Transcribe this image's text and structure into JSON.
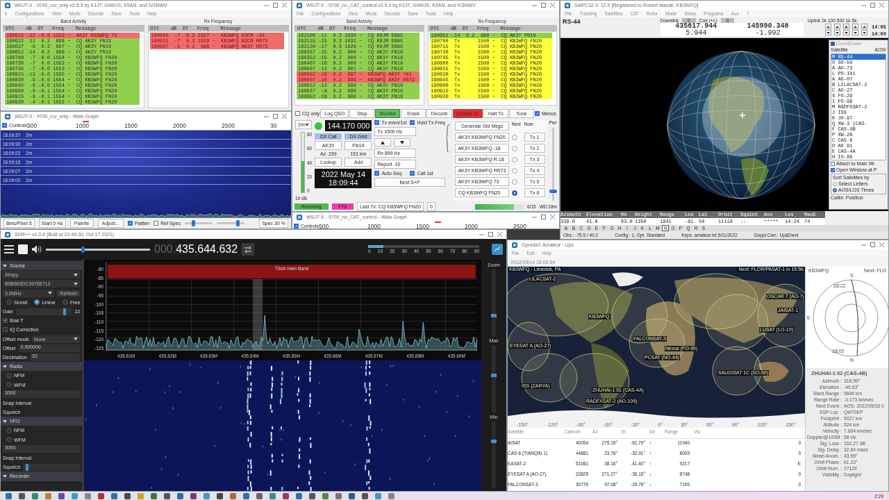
{
  "wsjtx_rcv_only": {
    "title": "WSJT-X - 9700_rcv_only   v2.5.3   by K1JT, G4WJS, K9AN, and IV3NWV",
    "menu": [
      "e",
      "Configurations",
      "View",
      "Mode",
      "Decode",
      "Save",
      "Tools",
      "Help"
    ],
    "band_activity": {
      "title": "Band Activity",
      "columns": [
        "UTC",
        "dB",
        "DT",
        "Freq",
        "Message"
      ],
      "rows": [
        {
          "text": "180615 -12 -0.0 1553 ~  AK3Y KB3WFQ 73",
          "kind": "reply"
        },
        {
          "text": "180622  11  0.2  898 ~  CQ AK3Y FN19",
          "kind": "cq"
        },
        {
          "text": "180637  -8  0.2  897 ~  CQ AK3Y FN19",
          "kind": "cq"
        },
        {
          "text": "180652 -14  0.2  899 ~  CQ AK3Y FN19",
          "kind": "cq"
        },
        {
          "text": "180700  -7 -0.0 1554 ~  CQ KB3WFQ FN20",
          "kind": "cq"
        },
        {
          "text": "180730  -7  0.0 1553 ~  CQ KB3WFQ FN20",
          "kind": "cq"
        },
        {
          "text": "180745  -7 -0.0 1553 ~  CQ KB3WFQ FN20",
          "kind": "cq"
        },
        {
          "text": "180815 -13 -0.0 1555 ~  CQ KB3WFQ FN20",
          "kind": "cq"
        },
        {
          "text": "180830  -9 -0.0 1554 ~  CQ KB3WFQ FN20",
          "kind": "cq"
        },
        {
          "text": "180845  -6 -0.0 1554 ~  CQ KB3WFQ FN20",
          "kind": "cq"
        },
        {
          "text": "180900  -9 -0.1 1554 ~  CQ KB3WFQ FN20",
          "kind": "cq"
        },
        {
          "text": "180915  -8 -0.1 1554 ~  CQ KB3WFQ FN20",
          "kind": "cq"
        },
        {
          "text": "180930  -4 -0.1 1553 ~  CQ KB3WFQ FN20",
          "kind": "cq"
        }
      ]
    },
    "rx_frequency": {
      "title": "Rx Frequency",
      "columns": [
        "UTC",
        "dB",
        "DT",
        "Freq",
        "Message"
      ],
      "rows": [
        {
          "text": "180600  -7  0.3 1557 ~  KB3WFQ N3CM -01",
          "kind": "reply"
        },
        {
          "text": "180615  -7  0.3 1559 ~  KB3WFQ N3CM RR73",
          "kind": "reply"
        },
        {
          "text": "180607  -5  0.2  898 ~  KB3WFQ AK3Y RR73",
          "kind": "reply"
        }
      ]
    }
  },
  "wide_graph_rcv_only": {
    "title": "WSJT-X - 9700_rcv_only - Wide Graph",
    "controls": {
      "label": "Controls",
      "checked": true
    },
    "scale": [
      "500",
      "1000",
      "1500",
      "2000",
      "2500",
      "30"
    ],
    "timestamps": [
      {
        "time": "18:09:37",
        "mode": "2m"
      },
      {
        "time": "18:09:30",
        "mode": "2m"
      },
      {
        "time": "18:09:22",
        "mode": "2m"
      },
      {
        "time": "18:09:15",
        "mode": "2m"
      },
      {
        "time": "18:09:07",
        "mode": "2m"
      },
      {
        "time": "18:09:00",
        "mode": "2m"
      }
    ],
    "bins_per_pixel": "Bins/Pixel  5",
    "start": "Start 0 Hz",
    "buttons": [
      "Palette",
      "Adjust..."
    ],
    "checks": [
      {
        "label": "Flatten",
        "checked": true
      },
      {
        "label": "Ref Spec",
        "checked": false
      }
    ],
    "sliders": [
      {
        "level": 0.3
      },
      {
        "level": 0.75
      }
    ],
    "spec": "Spec 30 %"
  },
  "wsjtx_no_cat": {
    "title": "WSJT-X - 9700_no_CAT_control   v2.5.3   by K1JT, G4WJS, K9AN, and IV3NWV",
    "menu": [
      "File",
      "Configurations",
      "View",
      "Mode",
      "Decode",
      "Save",
      "Tools",
      "Help"
    ],
    "band_activity": {
      "title": "Band Activity",
      "columns": [
        "UTC",
        "dB",
        "DT",
        "Freq",
        "Message"
      ],
      "rows": [
        {
          "text": "162100 -11  0.3 1030 ~  CQ K0JM EN85",
          "kind": "cq"
        },
        {
          "text": "162115 -15  0.3 1031 ~  CQ K0JM EN85",
          "kind": "cq"
        },
        {
          "text": "162130 -17  0.3 1029 ~  CQ K0JM EN85",
          "kind": "cq"
        },
        {
          "text": "180337 -15  0.2  900 ~  CQ AK3Y FN19",
          "kind": "cq"
        },
        {
          "text": "180352 -15  0.2  900 ~  CQ AK3Y FN19",
          "kind": "cq"
        },
        {
          "text": "180407 -16  0.2  900 ~  CQ AK3Y FN19",
          "kind": "cq"
        },
        {
          "text": "180507 -12  0.2  901 ~  CQ AK3Y FN19",
          "kind": "cq"
        },
        {
          "text": "180552 -18  0.2  897 ~  KB3WFQ AK3Y +01",
          "kind": "reply"
        },
        {
          "text": "180607 -10  0.2  899 ~  KB3WFQ AK3Y RR73",
          "kind": "reply"
        },
        {
          "text": "180622 -12  0.2  896 ~  CQ AK3Y FN19",
          "kind": "cq"
        },
        {
          "text": "180637  -8  0.2  896 ~  CQ AK3Y FN19",
          "kind": "cq"
        },
        {
          "text": "180652 -18  0.2  899 ~  CQ AK3Y FN19",
          "kind": "cq"
        }
      ]
    },
    "rx_frequency": {
      "title": "Rx Frequency",
      "columns": [
        "UTC",
        "dB",
        "DT",
        "Freq",
        "Message"
      ],
      "rows": [
        {
          "text": "180652 -14  0.2  899 ~  CQ AK3Y FN19",
          "kind": "cq"
        },
        {
          "text": "180700  Tx      1500 ~  CQ KB3WFQ FN20",
          "kind": "tx"
        },
        {
          "text": "180715  Tx      1500 ~  CQ KB3WFQ FN20",
          "kind": "tx"
        },
        {
          "text": "180730  Tx      1500 ~  CQ KB3WFQ FN20",
          "kind": "tx"
        },
        {
          "text": "180745  Tx      1500 ~  CQ KB3WFQ FN20",
          "kind": "tx"
        },
        {
          "text": "180800  Tx      1500 ~  CQ KB3WFQ FN20",
          "kind": "tx"
        },
        {
          "text": "180815  Tx      1500 ~  CQ KB3WFQ FN20",
          "kind": "tx"
        },
        {
          "text": "180830  Tx      1500 ~  CQ KB3WFQ FN20",
          "kind": "tx"
        },
        {
          "text": "180845  Tx      1500 ~  CQ KB3WFQ FN20",
          "kind": "tx"
        },
        {
          "text": "180900  Tx      1500 ~  CQ KB3WFQ FN20",
          "kind": "tx"
        },
        {
          "text": "180915  Tx      1500 ~  CQ KB3WFQ FN20",
          "kind": "tx"
        },
        {
          "text": "180930  Tx      1500 ~  CQ KB3WFQ FN20",
          "kind": "tx"
        }
      ]
    },
    "controls_row": [
      {
        "kind": "check",
        "label": "CQ only",
        "checked": false
      },
      {
        "kind": "button",
        "label": "Log QSO",
        "on": false
      },
      {
        "kind": "button",
        "label": "Stop",
        "on": false
      },
      {
        "kind": "button",
        "label": "Monitor",
        "on": true,
        "color": "#5ec45a"
      },
      {
        "kind": "button",
        "label": "Erase",
        "on": false
      },
      {
        "kind": "button",
        "label": "Decode",
        "on": false
      },
      {
        "kind": "button",
        "label": "Enable Tx",
        "on": true,
        "color": "#e8282c"
      },
      {
        "kind": "button",
        "label": "Halt Tx",
        "on": false
      },
      {
        "kind": "button",
        "label": "Tune",
        "on": false
      },
      {
        "kind": "check",
        "label": "Menus",
        "checked": true
      }
    ],
    "band": "2m",
    "frequency": "144.170 000",
    "dx_call_label": "DX Call",
    "dx_grid_label": "DX Grid",
    "dx_call": "AK3Y",
    "dx_grid": "FN19",
    "azimuth": "Az: 239",
    "distance": "151 km",
    "lookup": "Lookup",
    "add": "Add",
    "date": "2022 May 14",
    "time": "18:09:44",
    "meter": {
      "ticks": [
        "80",
        "60",
        "40",
        "20",
        "0"
      ],
      "level": 0.52,
      "reading": "14 dB"
    },
    "tx_even": {
      "label": "Tx even/1st",
      "checked": true
    },
    "hold_tx_freq": {
      "label": "Hold Tx Freq",
      "checked": true
    },
    "tx_freq": "Tx  1500 Hz",
    "rx_freq": "Rx  899 Hz",
    "report": "Report -10",
    "auto_seq": {
      "label": "Auto Seq",
      "checked": true
    },
    "call_1st": {
      "label": "Call 1st",
      "checked": true
    },
    "best_sp": "Best S+P",
    "messages": {
      "generate": "Generate Std Msgs",
      "next_label": "Next",
      "now_label": "Now",
      "rows": [
        {
          "text": "AK3Y KB3WFQ FN20",
          "selected": false,
          "now": "Tx 1"
        },
        {
          "text": "AK3Y KB3WFQ -18",
          "selected": false,
          "now": "Tx 2"
        },
        {
          "text": "AK3Y KB3WFQ R-18",
          "selected": false,
          "now": "Tx 3"
        },
        {
          "text": "AK3Y KB3WFQ RR73",
          "selected": false,
          "now": "Tx 4"
        },
        {
          "text": "AK3Y KB3WFQ 73",
          "selected": false,
          "now": "Tx 5"
        },
        {
          "text": "CQ KB3WFQ FN20",
          "selected": true,
          "now": "Tx 6"
        }
      ]
    },
    "power": {
      "label": "Pwr",
      "level": 0.12
    },
    "status_bar": {
      "state": "Receiving",
      "mode": "FT8",
      "last_tx": "Last Tx: CQ KB3WFQ FN20",
      "count": "0",
      "progress": {
        "level": 0.8
      },
      "period": "6/15",
      "watchdog": "WD:18m"
    }
  },
  "wide_graph_no_cat": {
    "title": "WSJT-X - 9700_no_CAT_control - Wide Graph",
    "controls": {
      "label": "Controls",
      "checked": true
    },
    "scale": [
      "500",
      "1000",
      "1500",
      "2000",
      "2500"
    ]
  },
  "satpc32": {
    "title": "SatPC32 V. 12.9   [Registered to Robert Mazde, KB3WFQ]",
    "menu": [
      "File",
      "Tracking",
      "Satellites",
      "CAT",
      "Rotor",
      "Mode",
      "Setup",
      "Programs",
      "Aux",
      "?"
    ],
    "satellite": "RS-44",
    "downlink_label": "Downlink",
    "downlink_value": "0",
    "corr_label": "Corr.(+/-)",
    "corr_value": "0",
    "uplink_label": "Uplink",
    "steps": [
      "2k",
      "100",
      "500",
      "1k",
      "5k"
    ],
    "downlink_freq": "435617.944",
    "uplink_freq": "145990.348",
    "downlink_doppler": "5.944",
    "uplink_doppler": "-1.992",
    "side_times": [
      "14:05",
      "14:09"
    ],
    "countdown": {
      "title": "CountDown",
      "columns": [
        "Satellite",
        "AOS/"
      ],
      "items": [
        {
          "letter": "M",
          "name": "RS-44",
          "selected": true
        },
        {
          "letter": "O",
          "name": "SO-50",
          "selected": false
        },
        {
          "letter": "A",
          "name": "AO-73",
          "selected": false
        },
        {
          "letter": "L",
          "name": "PO-101",
          "selected": false
        },
        {
          "letter": "A",
          "name": "AO-07",
          "selected": false
        },
        {
          "letter": "B",
          "name": "LILACSAT-2",
          "selected": false
        },
        {
          "letter": "C",
          "name": "AO-27",
          "selected": false
        },
        {
          "letter": "S",
          "name": "FO-29",
          "selected": false
        },
        {
          "letter": "I",
          "name": "FO-99",
          "selected": false
        },
        {
          "letter": "M",
          "name": "RADFXSAT-2",
          "selected": false
        },
        {
          "letter": "J",
          "name": "ISS",
          "selected": false
        },
        {
          "letter": "K",
          "name": "JO-97",
          "selected": false
        },
        {
          "letter": "Q",
          "name": "XW-3 (CAS-",
          "selected": false
        },
        {
          "letter": "F",
          "name": "CAS-4B",
          "selected": false
        },
        {
          "letter": "P",
          "name": "XW-2A",
          "selected": false
        },
        {
          "letter": "C",
          "name": "CAS-6",
          "selected": false
        },
        {
          "letter": "D",
          "name": "AO 91",
          "selected": false
        },
        {
          "letter": "E",
          "name": "CAS-4A",
          "selected": false
        },
        {
          "letter": "H",
          "name": "IO-86",
          "selected": false
        }
      ],
      "checks": [
        {
          "label": "Attach to Main Wi",
          "checked": false
        },
        {
          "label": "Open Window at P",
          "checked": true
        }
      ],
      "sort": {
        "title": "Sort Satellites by",
        "options": [
          {
            "label": "Select Letters",
            "selected": false
          },
          {
            "label": "AOS/LOS Times",
            "selected": true
          }
        ]
      },
      "calibr": "Calibr. Position"
    },
    "table": {
      "columns": [
        "Azimuth",
        "Elevation",
        "MA",
        "Height",
        "Range",
        "Lon",
        "Lat",
        "Orbit",
        "Squint",
        "Aos",
        "Los",
        "MaxE"
      ],
      "values": [
        "339.0",
        "41.8",
        "63.0",
        "1350",
        "1841",
        "-81",
        "50",
        "11118",
        "--",
        "*****",
        "14:24",
        "74"
      ]
    },
    "letters": [
      {
        "letter": "A",
        "selected": false
      },
      {
        "letter": "B",
        "selected": false
      },
      {
        "letter": "C",
        "selected": false
      },
      {
        "letter": "D",
        "selected": false
      },
      {
        "letter": "E",
        "selected": false
      },
      {
        "letter": "F",
        "selected": false
      },
      {
        "letter": "G",
        "selected": false
      },
      {
        "letter": "H",
        "selected": false
      },
      {
        "letter": "I",
        "selected": false
      },
      {
        "letter": "J",
        "selected": false
      },
      {
        "letter": "K",
        "selected": false
      },
      {
        "letter": "L",
        "selected": false
      },
      {
        "letter": "M",
        "selected": false
      },
      {
        "letter": "N",
        "selected": true
      },
      {
        "letter": "O",
        "selected": false
      },
      {
        "letter": "P",
        "selected": false
      },
      {
        "letter": "Q",
        "selected": false
      },
      {
        "letter": "R",
        "selected": false
      },
      {
        "letter": "S",
        "selected": false
      }
    ],
    "status_bar": [
      "Obs.: -75.5 / 40.2",
      "Config.: 1, Opt. Standard",
      "Keps: amateur.txt  5/11/2022",
      "Doppl.Corr.: Up&Dwnl"
    ]
  },
  "sdrpp": {
    "title": "SDR++ v1.0.4 (Built at 22:46:30, Oct 17 2021)",
    "volume": {
      "level": 0.35
    },
    "frequency": {
      "prefix": "000.",
      "digits": "435.644.632"
    },
    "snr": {
      "ticks": [
        "0",
        "10",
        "20",
        "30",
        "40",
        "50",
        "60",
        "70",
        "80",
        "90"
      ],
      "level": 0.14
    },
    "sidebar": [
      {
        "kind": "header",
        "label": "Source"
      },
      {
        "kind": "select",
        "value": "Airspy"
      },
      {
        "kind": "select",
        "value": "B58069DC39765713"
      },
      {
        "kind": "select",
        "value": "3.0MHz",
        "button": "Refresh"
      },
      {
        "kind": "radios",
        "options": [
          {
            "label": "Sensit",
            "selected": false
          },
          {
            "label": "Linear",
            "selected": true
          },
          {
            "label": "Free",
            "selected": false
          }
        ]
      },
      {
        "kind": "slider",
        "label": "Gain",
        "value": "13",
        "level": 0.9
      },
      {
        "kind": "check",
        "label": "Bias T",
        "checked": true
      },
      {
        "kind": "check",
        "label": "IQ Correction",
        "checked": false
      },
      {
        "kind": "select",
        "label": "Offset mode",
        "value": "None"
      },
      {
        "kind": "field",
        "label": "Offset",
        "value": "0.000000"
      },
      {
        "kind": "field",
        "label": "Decimation",
        "value": "32"
      },
      {
        "kind": "header",
        "label": "Radio"
      },
      {
        "kind": "radios",
        "options": [
          {
            "label": "NFM",
            "selected": false
          }
        ]
      },
      {
        "kind": "radios",
        "options": [
          {
            "label": "WFM",
            "selected": false
          }
        ]
      },
      {
        "kind": "field",
        "value": "3000"
      },
      {
        "kind": "text",
        "label": "Snap Interval"
      },
      {
        "kind": "text",
        "label": "Squelch"
      },
      {
        "kind": "header",
        "label": "VFO"
      },
      {
        "kind": "radios",
        "options": [
          {
            "label": "NFM",
            "selected": false
          }
        ]
      },
      {
        "kind": "radios",
        "options": [
          {
            "label": "WFM",
            "selected": false
          }
        ]
      },
      {
        "kind": "field",
        "value": "3000"
      },
      {
        "kind": "text",
        "label": "Snap Interval"
      },
      {
        "kind": "slider",
        "label": "Squelch",
        "level": 0.1
      },
      {
        "kind": "header",
        "label": "Recorder"
      }
    ],
    "fft": {
      "band_label": "70cm Ham Band",
      "yticks": [
        "-80",
        "-85",
        "-90",
        "-95",
        "-100",
        "-105",
        "-110",
        "-115",
        "-120",
        "-125"
      ],
      "xticks": [
        "435.61M",
        "435.62M",
        "435.63M",
        "435.64M",
        "435.65M",
        "435.66M",
        "435.67M",
        "435.68M",
        "435.69M"
      ]
    },
    "right_controls": [
      {
        "label": "Zoom",
        "level": 0.3
      },
      {
        "label": "Max",
        "level": 0.55
      },
      {
        "label": "Min",
        "level": 0.7
      }
    ]
  },
  "gpredict": {
    "title": "Gpredict: Amateur - Ups",
    "menu": [
      "File",
      "Edit",
      "Help"
    ],
    "timestamp": "2022/05/14 18:09:54",
    "map": {
      "qth": "KB3WFQ - Limerick, PA",
      "next": "Next: FLORIPASAT-1 in 15:56",
      "labels": [
        "LILACSAT-2",
        "KB3WFQ",
        "EYESAT A (AO-27)",
        "FALCONSAT-3",
        "Nexus (FO-99)",
        "PCSAT (NO-44)",
        "SAUDISAT 1C (SO-50)",
        "OSCAR 7 (AO-7)",
        "JAISAT-1",
        "LUSAT (LO-19)",
        "ZHUHAI-1 01 (CAS-4A)",
        "RADFXSAT-2 (AO-109)",
        "ISS (ZARYA)"
      ],
      "longitudes": [
        "-150°",
        "-120°",
        "-90°",
        "-60°",
        "-30°",
        "0°",
        "30°",
        "60°",
        "90°",
        "120°",
        "150°"
      ]
    },
    "polar": {
      "qth": "KB3WFQ",
      "next": "Next: FLO",
      "south": "S",
      "north": "N",
      "east": "E",
      "start_time": "18:22",
      "end_time": "18:02"
    },
    "table": {
      "columns": [
        "Satellite",
        "Catnum",
        "Az",
        "El",
        "Dir",
        "Range",
        "Vis"
      ],
      "rows": [
        {
          "cells": [
            "AISAT",
            "40054",
            "275.15°",
            "-61.70°",
            "↑",
            "11940",
            "0"
          ]
        },
        {
          "cells": [
            "CAS-6 (TIANQIN 1)",
            "44881",
            "23.76°",
            "-32.91°",
            "↑",
            "8009",
            "0"
          ]
        },
        {
          "cells": [
            "EASAT-2",
            "51081",
            "38.16°",
            "-41.40°",
            "↑",
            "9217",
            "E"
          ]
        },
        {
          "cells": [
            "EYESAT A (AO-27)",
            "22825",
            "271.27°",
            "-36.15°",
            "↓",
            "8748",
            "0"
          ]
        },
        {
          "cells": [
            "FALCONSAT-3",
            "30776",
            "97.08°",
            "-29.76°",
            "↓",
            "7100",
            "0"
          ]
        }
      ]
    },
    "details": {
      "title": "ZHUHAI-1 02 (CAS-4B)",
      "fields": [
        {
          "label": "Azimuth :",
          "value": "318.99°"
        },
        {
          "label": "Elevation :",
          "value": "-45.63°"
        },
        {
          "label": "Slant Range :",
          "value": "9846 km"
        },
        {
          "label": "Range Rate :",
          "value": "-0.173 km/sec"
        },
        {
          "label": "Next Event :",
          "value": "AOS: 2022/05/15 0"
        },
        {
          "label": "SSP Loc. :",
          "value": "QM70EP"
        },
        {
          "label": "Footprint :",
          "value": "5027 km"
        },
        {
          "label": "Altitude :",
          "value": "524 km"
        },
        {
          "label": "Velocity :",
          "value": "7.604 km/sec"
        },
        {
          "label": "Doppler@100M :",
          "value": "58 Hz"
        },
        {
          "label": "Sig. Loss :",
          "value": "152.27 dB"
        },
        {
          "label": "Sig. Delay :",
          "value": "32.84 msec"
        },
        {
          "label": "Mean Anom. :",
          "value": "43.59°"
        },
        {
          "label": "Orbit Phase :",
          "value": "61.23°"
        },
        {
          "label": "Orbit Num. :",
          "value": "27129"
        },
        {
          "label": "Visibility :",
          "value": "Daylight"
        }
      ]
    }
  },
  "taskbar": {
    "clock": "2:29"
  }
}
